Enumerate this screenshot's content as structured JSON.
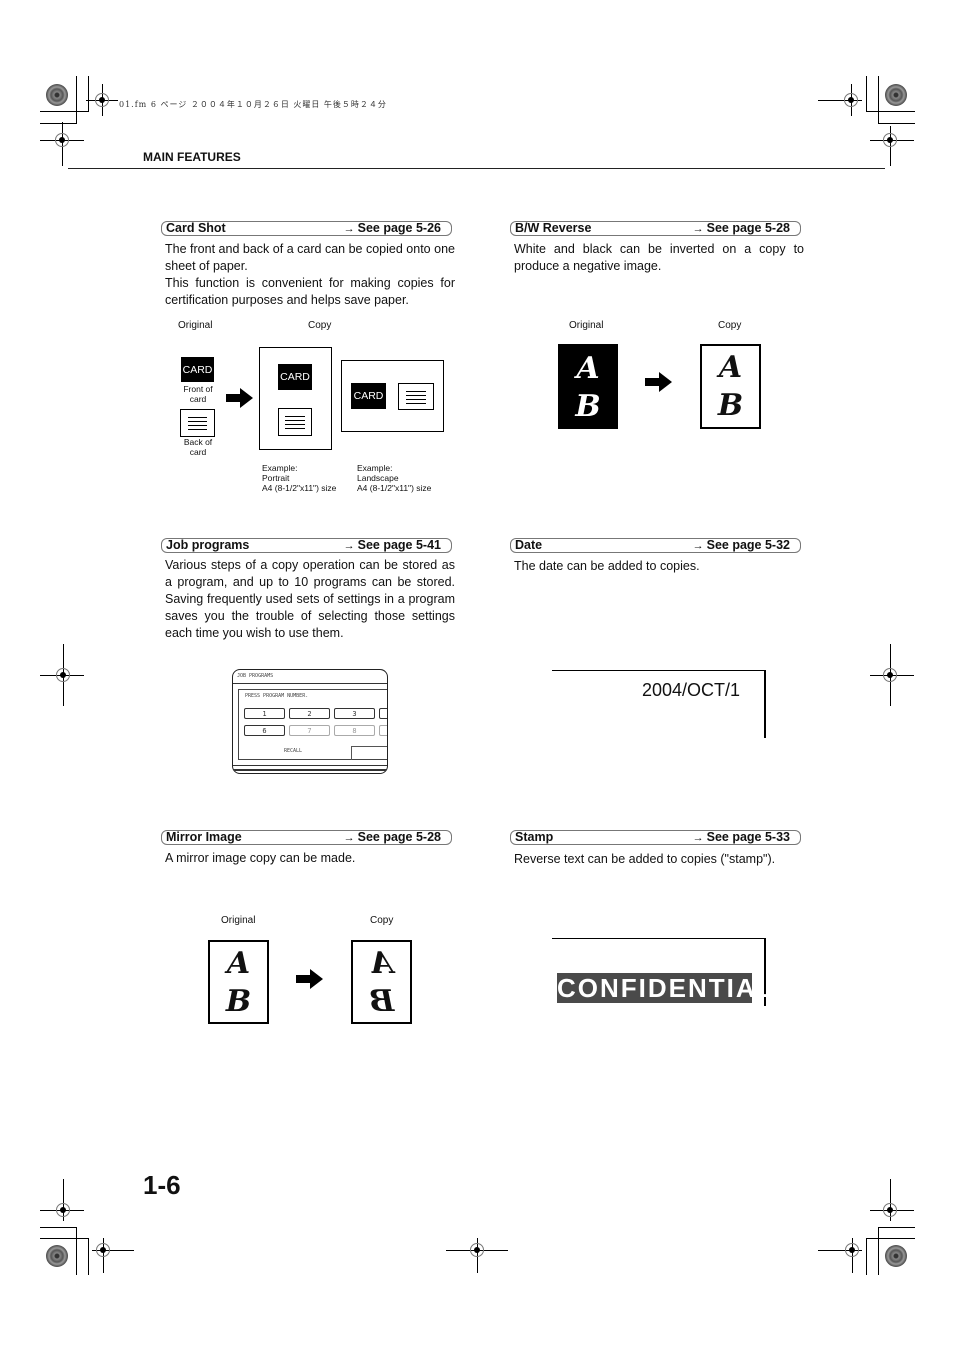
{
  "slug": "01.fm  6 ページ  ２００４年１０月２６日  火曜日  午後５時２４分",
  "header": {
    "title": "MAIN FEATURES"
  },
  "sections": {
    "card_shot": {
      "title": "Card Shot",
      "ref": "See page 5-26",
      "arrow": "→",
      "description": "The front and back of a card can be copied onto one sheet of paper.",
      "description2": "This function is convenient for making copies for certification purposes and helps save paper.",
      "fig": {
        "original_label": "Original",
        "copy_label": "Copy",
        "card_text": "CARD",
        "front_label": "Front of card",
        "back_label": "Back of card",
        "example_portrait": [
          "Example:",
          "Portrait",
          "A4 (8-1/2\"x11\") size"
        ],
        "example_landscape": [
          "Example:",
          "Landscape",
          "A4 (8-1/2\"x11\") size"
        ]
      }
    },
    "bw_reverse": {
      "title": "B/W Reverse",
      "ref": "See page 5-28",
      "arrow": "→",
      "description": "White and black can be inverted on a copy to produce a negative image.",
      "fig": {
        "original_label": "Original",
        "copy_label": "Copy",
        "letter_a": "A",
        "letter_b": "B"
      }
    },
    "job_programs": {
      "title": "Job programs",
      "ref": "See page 5-41",
      "arrow": "→",
      "description": "Various steps of a copy operation can be stored as a program, and up to 10 programs can be stored. Saving frequently used sets of settings in a program saves you the trouble of selecting those settings each time you wish to use them.",
      "panel": {
        "title": "JOB PROGRAMS",
        "prompt": "PRESS PROGRAM NUMBER.",
        "buttons_row1": [
          "1",
          "2",
          "3"
        ],
        "buttons_row2": [
          "6",
          "7",
          "8"
        ],
        "recall": "RECALL"
      }
    },
    "date": {
      "title": "Date",
      "ref": "See page 5-32",
      "arrow": "→",
      "description": "The date can be added to copies.",
      "sample": "2004/OCT/1"
    },
    "mirror_image": {
      "title": "Mirror Image",
      "ref": "See page 5-28",
      "arrow": "→",
      "description": "A mirror image copy can be made.",
      "fig": {
        "original_label": "Original",
        "copy_label": "Copy",
        "letter_a": "A",
        "letter_b": "B"
      }
    },
    "stamp": {
      "title": "Stamp",
      "ref": "See page 5-33",
      "arrow": "→",
      "description": "Reverse text can be added to copies (\"stamp\").",
      "sample": "CONFIDENTIAL"
    }
  },
  "footer": {
    "page_number": "1-6"
  }
}
